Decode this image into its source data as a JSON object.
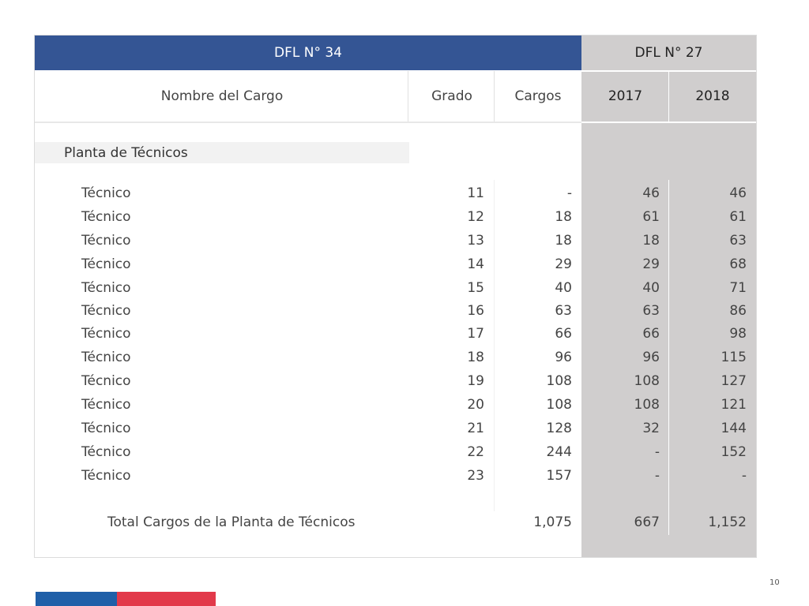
{
  "header": {
    "group_left": "DFL N° 34",
    "group_right": "DFL N° 27",
    "columns": [
      "Nombre del Cargo",
      "Grado",
      "Cargos",
      "2017",
      "2018"
    ]
  },
  "section": {
    "title": "Planta de Técnicos"
  },
  "rows": [
    {
      "name": "Técnico",
      "grado": "11",
      "cargos": "-",
      "y2017": "46",
      "y2018": "46"
    },
    {
      "name": "Técnico",
      "grado": "12",
      "cargos": "18",
      "y2017": "61",
      "y2018": "61"
    },
    {
      "name": "Técnico",
      "grado": "13",
      "cargos": "18",
      "y2017": "18",
      "y2018": "63"
    },
    {
      "name": "Técnico",
      "grado": "14",
      "cargos": "29",
      "y2017": "29",
      "y2018": "68"
    },
    {
      "name": "Técnico",
      "grado": "15",
      "cargos": "40",
      "y2017": "40",
      "y2018": "71"
    },
    {
      "name": "Técnico",
      "grado": "16",
      "cargos": "63",
      "y2017": "63",
      "y2018": "86"
    },
    {
      "name": "Técnico",
      "grado": "17",
      "cargos": "66",
      "y2017": "66",
      "y2018": "98"
    },
    {
      "name": "Técnico",
      "grado": "18",
      "cargos": "96",
      "y2017": "96",
      "y2018": "115"
    },
    {
      "name": "Técnico",
      "grado": "19",
      "cargos": "108",
      "y2017": "108",
      "y2018": "127"
    },
    {
      "name": "Técnico",
      "grado": "20",
      "cargos": "108",
      "y2017": "108",
      "y2018": "121"
    },
    {
      "name": "Técnico",
      "grado": "21",
      "cargos": "128",
      "y2017": "32",
      "y2018": "144"
    },
    {
      "name": "Técnico",
      "grado": "22",
      "cargos": "244",
      "y2017": "-",
      "y2018": "152"
    },
    {
      "name": "Técnico",
      "grado": "23",
      "cargos": "157",
      "y2017": "-",
      "y2018": "-"
    }
  ],
  "total": {
    "name": "Total Cargos de la Planta de Técnicos",
    "cargos": "1,075",
    "y2017": "667",
    "y2018": "1,152"
  },
  "footer": {
    "page_number": "10"
  },
  "colors": {
    "header_blue": "#345594",
    "gray_band": "#d0cece",
    "flag_blue": "#1f5fa8",
    "flag_red": "#e2394a"
  }
}
